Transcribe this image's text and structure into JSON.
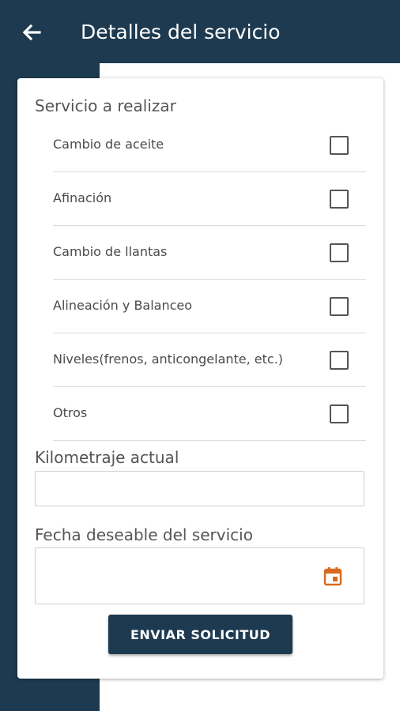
{
  "app_bar": {
    "title": "Detalles del servicio",
    "back_icon": "arrow-left-icon",
    "background_color": "#1d3a50"
  },
  "form": {
    "services_label": "Servicio a realizar",
    "services": [
      {
        "label": "Cambio de aceite",
        "checked": false
      },
      {
        "label": "Afinación",
        "checked": false
      },
      {
        "label": "Cambio de llantas",
        "checked": false
      },
      {
        "label": "Alineación y Balanceo",
        "checked": false
      },
      {
        "label": "Niveles(frenos, anticongelante, etc.)",
        "checked": false
      },
      {
        "label": "Otros",
        "checked": false
      }
    ],
    "mileage_label": "Kilometraje actual",
    "mileage_value": "",
    "date_label": "Fecha deseable del servicio",
    "date_value": "",
    "calendar_icon": "calendar-icon",
    "calendar_icon_color": "#d9691e",
    "submit_label": "ENVIAR SOLICITUD"
  }
}
